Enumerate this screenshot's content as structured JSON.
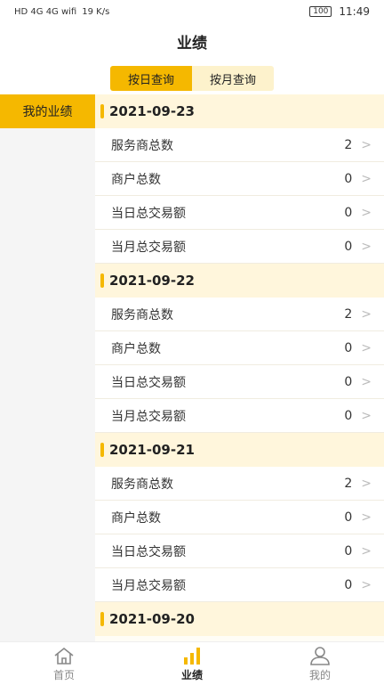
{
  "status": {
    "left_icons": "HD 4G 4G wifi",
    "speed": "19 K/s",
    "battery": "100",
    "time": "11:49"
  },
  "header": {
    "title": "业绩"
  },
  "toggle": {
    "by_day": "按日查询",
    "by_month": "按月查询"
  },
  "sidebar": {
    "items": [
      {
        "label": "我的业绩"
      }
    ]
  },
  "days": [
    {
      "date": "2021-09-23",
      "rows": [
        {
          "label": "服务商总数",
          "value": "2"
        },
        {
          "label": "商户总数",
          "value": "0"
        },
        {
          "label": "当日总交易额",
          "value": "0"
        },
        {
          "label": "当月总交易额",
          "value": "0"
        }
      ]
    },
    {
      "date": "2021-09-22",
      "rows": [
        {
          "label": "服务商总数",
          "value": "2"
        },
        {
          "label": "商户总数",
          "value": "0"
        },
        {
          "label": "当日总交易额",
          "value": "0"
        },
        {
          "label": "当月总交易额",
          "value": "0"
        }
      ]
    },
    {
      "date": "2021-09-21",
      "rows": [
        {
          "label": "服务商总数",
          "value": "2"
        },
        {
          "label": "商户总数",
          "value": "0"
        },
        {
          "label": "当日总交易额",
          "value": "0"
        },
        {
          "label": "当月总交易额",
          "value": "0"
        }
      ]
    },
    {
      "date": "2021-09-20",
      "rows": []
    }
  ],
  "tabbar": {
    "home": "首页",
    "performance": "业绩",
    "mine": "我的"
  },
  "colors": {
    "accent": "#f5b800"
  }
}
